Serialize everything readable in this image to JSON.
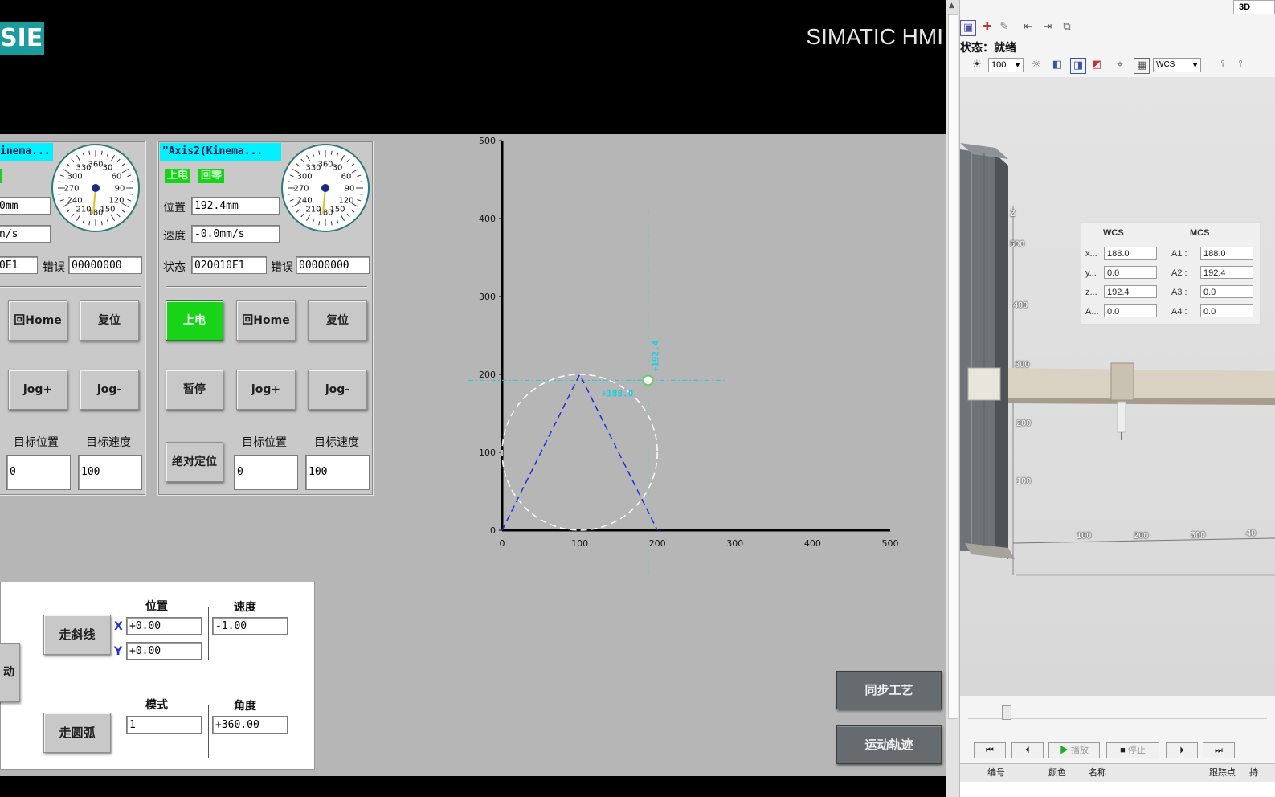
{
  "hmi": {
    "logo": "SIEMENS",
    "product": "SIMATIC HMI"
  },
  "axis1": {
    "name": "inema...",
    "position": "0mm",
    "speed": "n/s",
    "status": "0E1",
    "error_label": "错误",
    "error": "00000000",
    "btn_home": "回Home",
    "btn_reset": "复位",
    "btn_jog_plus": "jog+",
    "btn_jog_minus": "jog-",
    "target_pos_label": "目标位置",
    "target_speed_label": "目标速度",
    "target_pos": "0",
    "target_speed": "100"
  },
  "axis2": {
    "name": "\"Axis2(Kinema...",
    "lamp_power": "上电",
    "lamp_home": "回零",
    "position_label": "位置",
    "position": "192.4mm",
    "speed_label": "速度",
    "speed": "-0.0mm/s",
    "status_label": "状态",
    "status": "020010E1",
    "error_label": "错误",
    "error": "00000000",
    "btn_power": "上电",
    "btn_home": "回Home",
    "btn_reset": "复位",
    "btn_pause": "暂停",
    "btn_jog_plus": "jog+",
    "btn_jog_minus": "jog-",
    "btn_abs_pos": "绝对定位",
    "target_pos_label": "目标位置",
    "target_speed_label": "目标速度",
    "target_pos": "0",
    "target_speed": "100"
  },
  "gauge": {
    "labels": [
      "330",
      "360",
      "30",
      "300",
      "60",
      "270",
      "90",
      "240",
      "120",
      "210",
      "180",
      "150"
    ]
  },
  "chart_data": {
    "type": "line",
    "x_ticks": [
      "0",
      "100",
      "200",
      "300",
      "400",
      "500"
    ],
    "y_ticks": [
      "0",
      "100",
      "200",
      "300",
      "400",
      "500"
    ],
    "xlim": [
      0,
      500
    ],
    "ylim": [
      0,
      500
    ],
    "series": [
      {
        "points": [
          [
            0,
            0
          ],
          [
            100,
            200
          ],
          [
            200,
            0
          ]
        ],
        "color": "#2a2ae0",
        "style": "dashed"
      }
    ],
    "circle": {
      "cx": 100,
      "cy": 100,
      "r": 100,
      "color": "#ffffff",
      "style": "dashed"
    },
    "crosshair": {
      "x": 188,
      "y": 192.4,
      "color": "#19d0e0"
    },
    "crosshair_x_label": "+188.0",
    "crosshair_y_label": "+192.4"
  },
  "motion": {
    "left_btn": "动",
    "btn_line": "走斜线",
    "position_label": "位置",
    "speed_label": "速度",
    "x_label": "X",
    "y_label": "Y",
    "x_value": "+0.00",
    "y_value": "+0.00",
    "speed_value": "-1.00",
    "btn_arc": "走圆弧",
    "mode_label": "模式",
    "angle_label": "角度",
    "mode_value": "1",
    "angle_value": "+360.00"
  },
  "nav": {
    "btn_sync": "同步工艺",
    "btn_trajectory": "运动轨迹"
  },
  "tia": {
    "top_label": "3D ",
    "status": "状态：就绪",
    "zoom": "100",
    "coord_sys": "WCS",
    "wcs_header": "WCS",
    "mcs_header": "MCS",
    "wcs_labels": [
      "x...",
      "y...",
      "z...",
      "A..."
    ],
    "wcs_values": [
      "188.0",
      "0.0",
      "192.4",
      "0.0"
    ],
    "mcs_labels": [
      "A1 :",
      "A2 :",
      "A3 :",
      "A4 :"
    ],
    "mcs_values": [
      "188.0",
      "192.4",
      "0.0",
      "0.0"
    ],
    "axis_z": "Z",
    "z_ticks": [
      "500",
      "400",
      "300",
      "200",
      "100"
    ],
    "x_ticks": [
      "100",
      "200",
      "300",
      "40"
    ],
    "play_label": "播放",
    "stop_label": "停止",
    "col_number": "编号",
    "col_color": "颜色",
    "col_name": "名称",
    "col_trace": "跟踪点",
    "col_more": "持"
  },
  "colors": {
    "accent_cyan": "#00f0ff",
    "lamp_green": "#18d418",
    "screen_gray": "#b6b6b6"
  }
}
